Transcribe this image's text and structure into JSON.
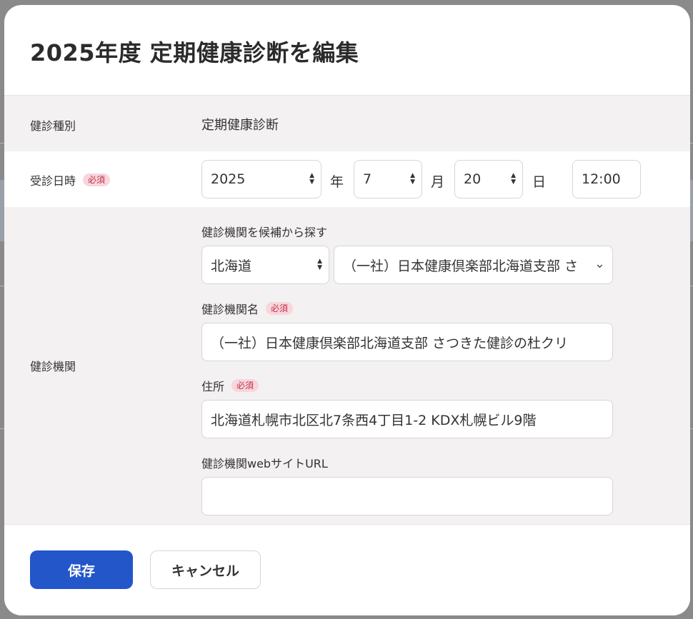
{
  "modal": {
    "title": "2025年度 定期健康診断を編集"
  },
  "required_badge": "必須",
  "exam_type": {
    "label": "健診種別",
    "value": "定期健康診断"
  },
  "exam_date": {
    "label": "受診日時",
    "year": "2025",
    "year_unit": "年",
    "month": "7",
    "month_unit": "月",
    "day": "20",
    "day_unit": "日",
    "time": "12:00"
  },
  "institution": {
    "label": "健診機関",
    "search_label": "健診機関を候補から探す",
    "prefecture": "北海道",
    "candidate": "（一社）日本健康倶楽部北海道支部 さ",
    "name_label": "健診機関名",
    "name_value": "（一社）日本健康倶楽部北海道支部 さつきた健診の杜クリ",
    "address_label": "住所",
    "address_value": "北海道札幌市北区北7条西4丁目1-2 KDX札幌ビル9階",
    "url_label": "健診機関webサイトURL",
    "url_value": ""
  },
  "footer": {
    "save_label": "保存",
    "cancel_label": "キャンセル"
  }
}
